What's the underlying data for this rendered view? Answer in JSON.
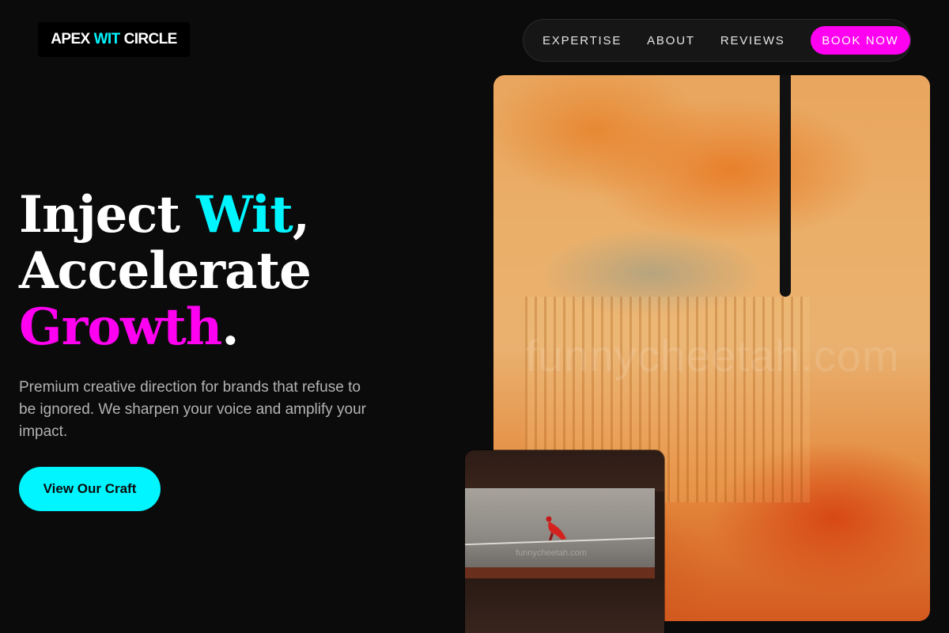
{
  "brand": {
    "name_part1": "APEX",
    "name_accent": "WIT",
    "name_part2": "CIRCLE"
  },
  "nav": {
    "items": [
      {
        "label": "EXPERTISE"
      },
      {
        "label": "ABOUT"
      },
      {
        "label": "REVIEWS"
      }
    ],
    "cta_label": "BOOK NOW"
  },
  "hero": {
    "headline_line1_a": "Inject ",
    "headline_line1_accent": "Wit",
    "headline_line1_b": ",",
    "headline_line2": "Accelerate",
    "headline_line3_accent": "Growth",
    "headline_line3_b": ".",
    "subtext": "Premium creative direction for brands that refuse to be ignored. We sharpen your voice and amplify your impact.",
    "cta_label": "View Our Craft"
  },
  "media": {
    "main_watermark": "funnycheetah.com",
    "photo_watermark": "funnycheetah.com"
  },
  "colors": {
    "background": "#0b0b0b",
    "accent_cyan": "#00f5ff",
    "accent_magenta": "#ff00f0",
    "nav_background": "#161616",
    "body_text_muted": "#b3b3b3"
  }
}
